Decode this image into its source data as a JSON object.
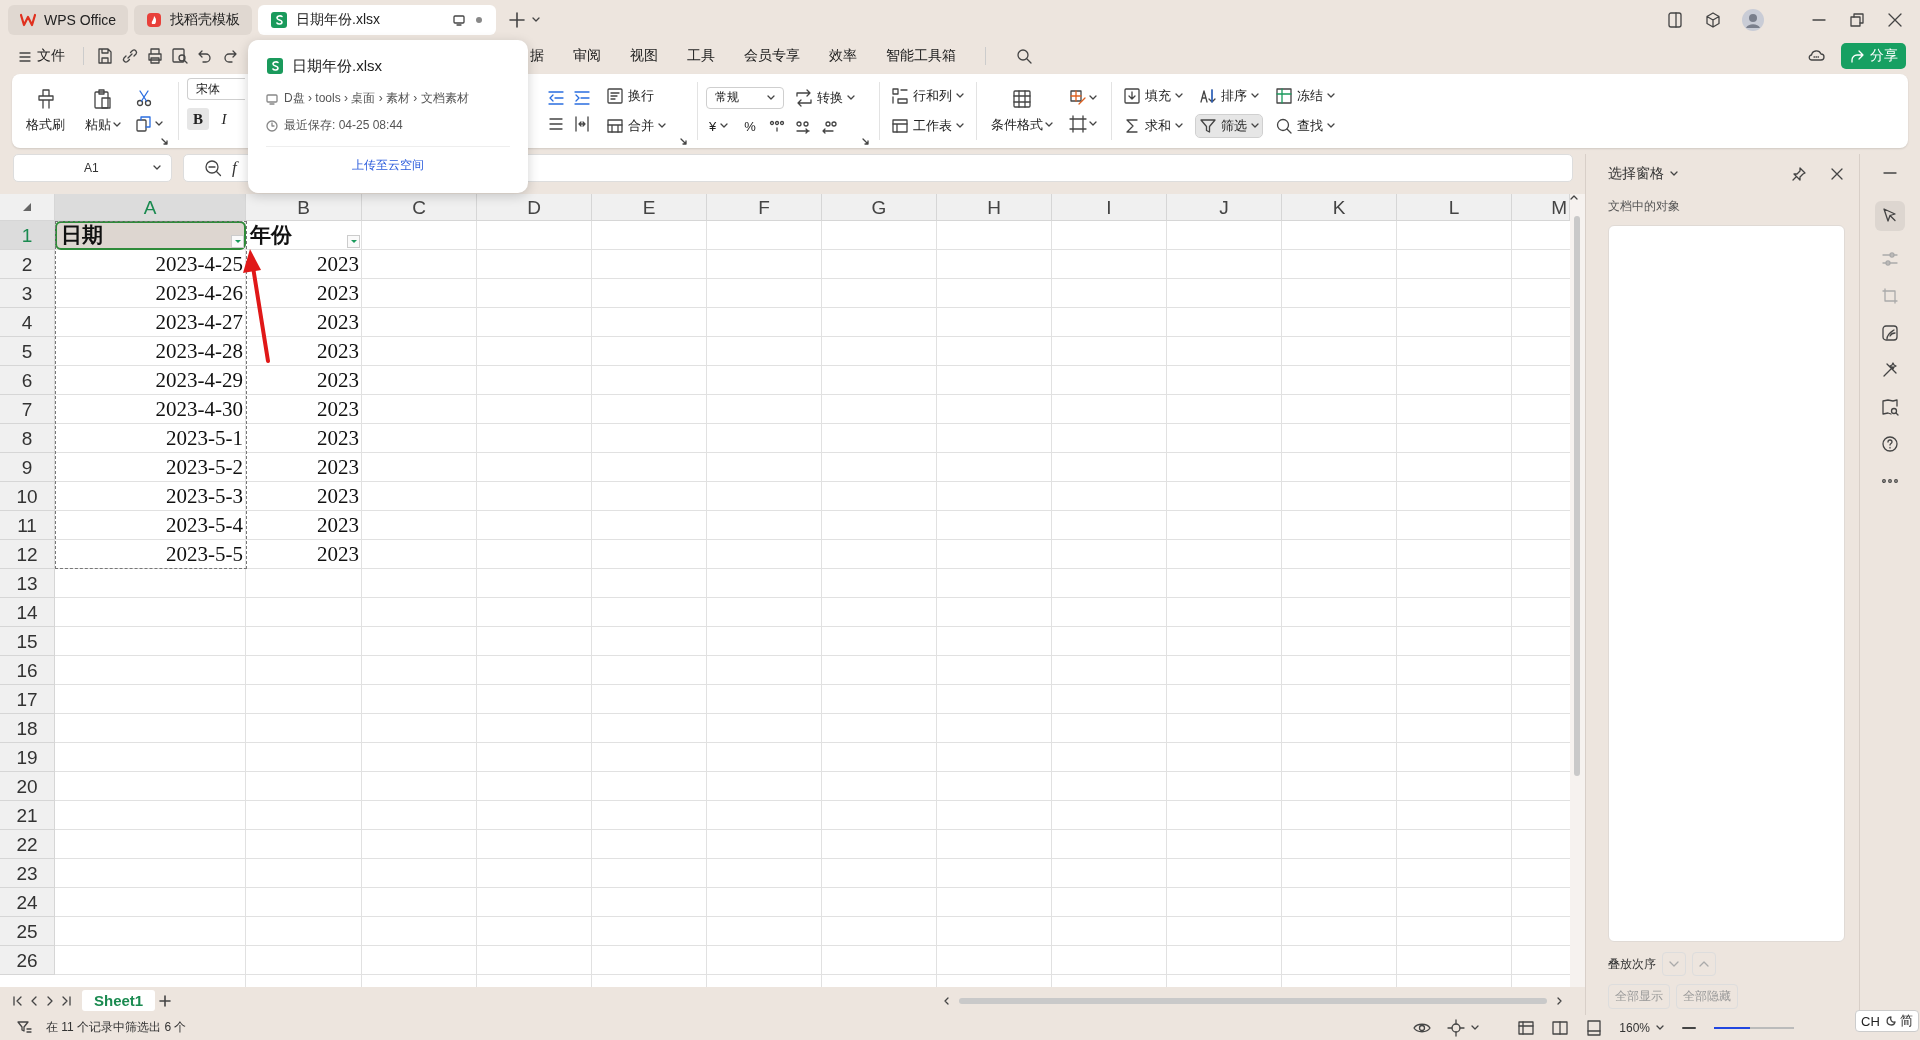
{
  "tabs": [
    {
      "label": "WPS Office",
      "selected": false
    },
    {
      "label": "找稻壳模板",
      "selected": false
    },
    {
      "label": "日期年份.xlsx",
      "selected": true
    }
  ],
  "menu": {
    "file": "文件",
    "items": [
      "据",
      "审阅",
      "视图",
      "工具",
      "会员专享",
      "效率",
      "智能工具箱"
    ],
    "share": "分享"
  },
  "ribbon": {
    "format_painter": "格式刷",
    "paste": "粘贴",
    "font_name": "宋体",
    "font_buttons": [
      {
        "label": "B",
        "selected": true
      },
      {
        "label": "I",
        "selected": false
      }
    ],
    "wrap": "换行",
    "merge": "合并",
    "number_format": "常规",
    "convert": "转换",
    "symbols": [
      "¥",
      "%"
    ],
    "rows_cols": "行和列",
    "worksheet": "工作表",
    "cond_format": "条件格式",
    "edit": [
      {
        "label": "填充",
        "selected": false
      },
      {
        "label": "排序",
        "selected": false
      },
      {
        "label": "冻结",
        "selected": false
      },
      {
        "label": "求和",
        "selected": false
      },
      {
        "label": "筛选",
        "selected": true
      },
      {
        "label": "查找",
        "selected": false
      }
    ]
  },
  "popup": {
    "title": "日期年份.xlsx",
    "path": "D盘 › tools › 桌面 › 素材 › 文档素材",
    "saved": "最近保存: 04-25 08:44",
    "upload": "上传至云空间"
  },
  "sheet": {
    "name_box": "A1",
    "fx": "f",
    "columns": [
      {
        "label": "A",
        "selected": true
      },
      {
        "label": "B",
        "selected": false
      },
      {
        "label": "C",
        "selected": false
      },
      {
        "label": "D",
        "selected": false
      },
      {
        "label": "E",
        "selected": false
      },
      {
        "label": "F",
        "selected": false
      },
      {
        "label": "G",
        "selected": false
      },
      {
        "label": "H",
        "selected": false
      },
      {
        "label": "I",
        "selected": false
      },
      {
        "label": "J",
        "selected": false
      },
      {
        "label": "K",
        "selected": false
      },
      {
        "label": "L",
        "selected": false
      },
      {
        "label": "M",
        "selected": false
      }
    ],
    "header_row": {
      "number": "1",
      "selected": true,
      "cells": [
        {
          "text": "日期",
          "filter": true,
          "selected": true
        },
        {
          "text": "年份",
          "filter": true,
          "selected": false
        }
      ]
    },
    "rows": [
      {
        "number": "2",
        "cells": [
          "2023-4-25",
          "2023"
        ]
      },
      {
        "number": "3",
        "cells": [
          "2023-4-26",
          "2023"
        ]
      },
      {
        "number": "4",
        "cells": [
          "2023-4-27",
          "2023"
        ]
      },
      {
        "number": "5",
        "cells": [
          "2023-4-28",
          "2023"
        ]
      },
      {
        "number": "6",
        "cells": [
          "2023-4-29",
          "2023"
        ]
      },
      {
        "number": "7",
        "cells": [
          "2023-4-30",
          "2023"
        ]
      },
      {
        "number": "8",
        "cells": [
          "2023-5-1",
          "2023"
        ]
      },
      {
        "number": "9",
        "cells": [
          "2023-5-2",
          "2023"
        ]
      },
      {
        "number": "10",
        "cells": [
          "2023-5-3",
          "2023"
        ]
      },
      {
        "number": "11",
        "cells": [
          "2023-5-4",
          "2023"
        ]
      },
      {
        "number": "12",
        "cells": [
          "2023-5-5",
          "2023"
        ]
      },
      {
        "number": "13"
      },
      {
        "number": "14"
      },
      {
        "number": "15"
      },
      {
        "number": "16"
      },
      {
        "number": "17"
      },
      {
        "number": "18"
      },
      {
        "number": "19"
      },
      {
        "number": "20"
      },
      {
        "number": "21"
      },
      {
        "number": "22"
      },
      {
        "number": "23"
      },
      {
        "number": "24"
      },
      {
        "number": "25"
      },
      {
        "number": "26"
      }
    ]
  },
  "sheet_tabs": [
    {
      "label": "Sheet1",
      "selected": true
    }
  ],
  "pane": {
    "title": "选择窗格",
    "objects_label": "文档中的对象",
    "order_label": "叠放次序",
    "buttons": [
      "全部显示",
      "全部隐藏"
    ]
  },
  "status": {
    "text": "在 11 个记录中筛选出 6 个",
    "zoom": "160%",
    "zoom_slider": {
      "level": 0.45
    }
  },
  "ime": {
    "lang": "CH",
    "mode": "简"
  }
}
